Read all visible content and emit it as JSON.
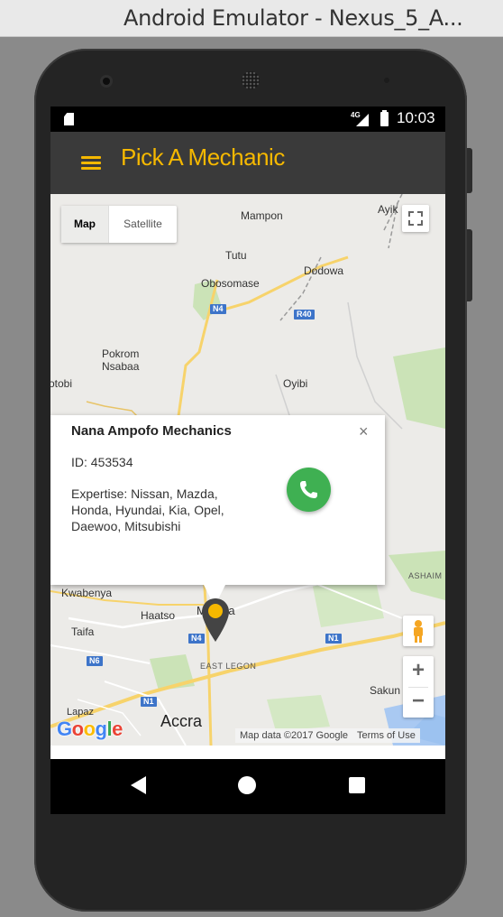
{
  "window": {
    "title": "Android Emulator - Nexus_5_A..."
  },
  "statusbar": {
    "network": "4G",
    "time": "10:03"
  },
  "appbar": {
    "title": "Pick A Mechanic",
    "menu_icon": "hamburger-menu-icon"
  },
  "map": {
    "type_control": {
      "map_label": "Map",
      "satellite_label": "Satellite"
    },
    "labels": {
      "mampon": "Mampon",
      "ayik": "Ayik",
      "tutu": "Tutu",
      "dodowa": "Dodowa",
      "obosomase": "Obosomase",
      "pokrom": "Pokrom\nNsabaa",
      "otobi": "otobi",
      "oyibi": "Oyibi",
      "kwabenya": "Kwabenya",
      "haatso": "Haatso",
      "madina": "Madina",
      "taifa": "Taifa",
      "east_legon": "EAST LEGON",
      "ashaim": "ASHAIM",
      "sakun": "Sakun",
      "lapaz": "Lapaz",
      "accra": "Accra"
    },
    "shields": {
      "n4a": "N4",
      "r40": "R40",
      "n4b": "N4",
      "n1a": "N1",
      "n6": "N6",
      "n1b": "N1"
    },
    "logo": "Google",
    "attribution": {
      "data": "Map data ©2017 Google",
      "terms": "Terms of Use"
    },
    "zoom": {
      "in": "+",
      "out": "−"
    }
  },
  "infowindow": {
    "title": "Nana Ampofo Mechanics",
    "id_text": "ID: 453534",
    "expertise_text": "Expertise: Nissan, Mazda, Honda, Hyundai, Kia, Opel, Daewoo, Mitsubishi",
    "close": "×",
    "call_icon": "phone-icon"
  },
  "colors": {
    "accent": "#f5b800",
    "appbar": "#3a3a3a",
    "call": "#3fb052",
    "road_shield": "#3d74c9"
  }
}
